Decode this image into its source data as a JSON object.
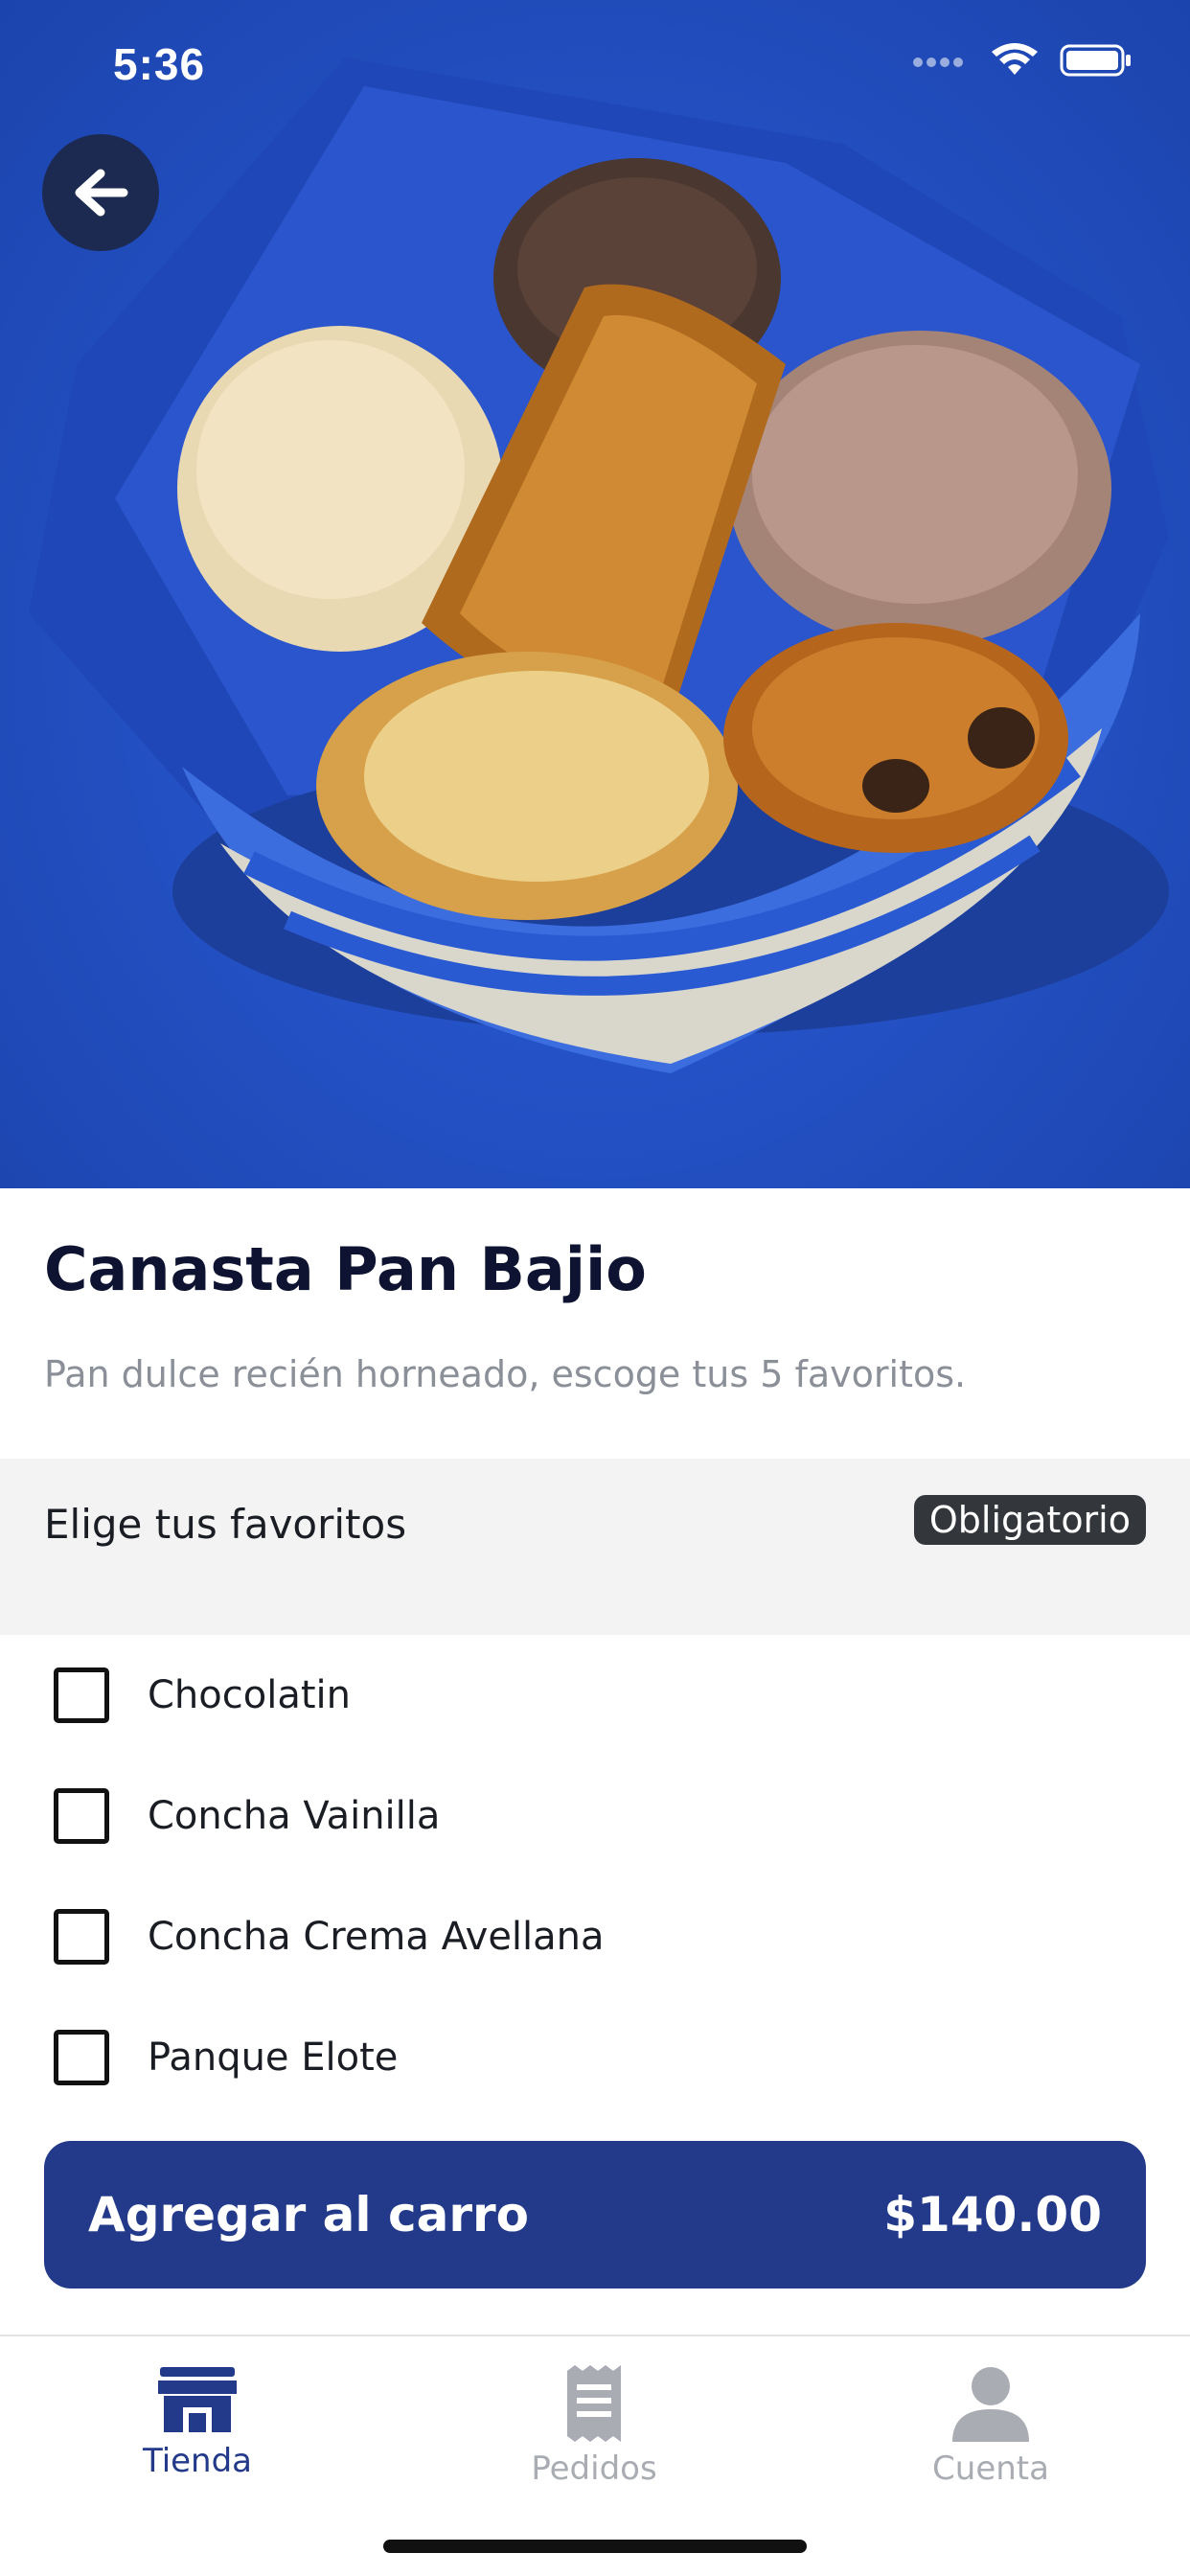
{
  "status_bar": {
    "time": "5:36",
    "icons": [
      "signal-icon",
      "wifi-icon",
      "battery-icon"
    ]
  },
  "navigation": {
    "back_icon": "arrow-left-icon"
  },
  "product": {
    "title": "Canasta Pan Bajio",
    "description": "Pan dulce recién horneado, escoge tus 5 favoritos.",
    "image_subject": "bread-basket-photo"
  },
  "options_section": {
    "title": "Elige tus favoritos",
    "badge": "Obligatorio",
    "items": [
      {
        "label": "Chocolatin",
        "checked": false
      },
      {
        "label": "Concha Vainilla",
        "checked": false
      },
      {
        "label": "Concha Crema Avellana",
        "checked": false
      },
      {
        "label": "Panque Elote",
        "checked": false
      }
    ]
  },
  "cart_button": {
    "label": "Agregar al carro",
    "price": "$140.00"
  },
  "tab_bar": {
    "tabs": [
      {
        "label": "Tienda",
        "icon": "store-icon",
        "active": true
      },
      {
        "label": "Pedidos",
        "icon": "receipt-icon",
        "active": false
      },
      {
        "label": "Cuenta",
        "icon": "user-icon",
        "active": false
      }
    ]
  },
  "colors": {
    "accent": "#233a8a",
    "hero_background": "#2452c6",
    "badge_background": "#33363b",
    "section_background": "#f3f3f4",
    "inactive_tab": "#a9acb2"
  }
}
